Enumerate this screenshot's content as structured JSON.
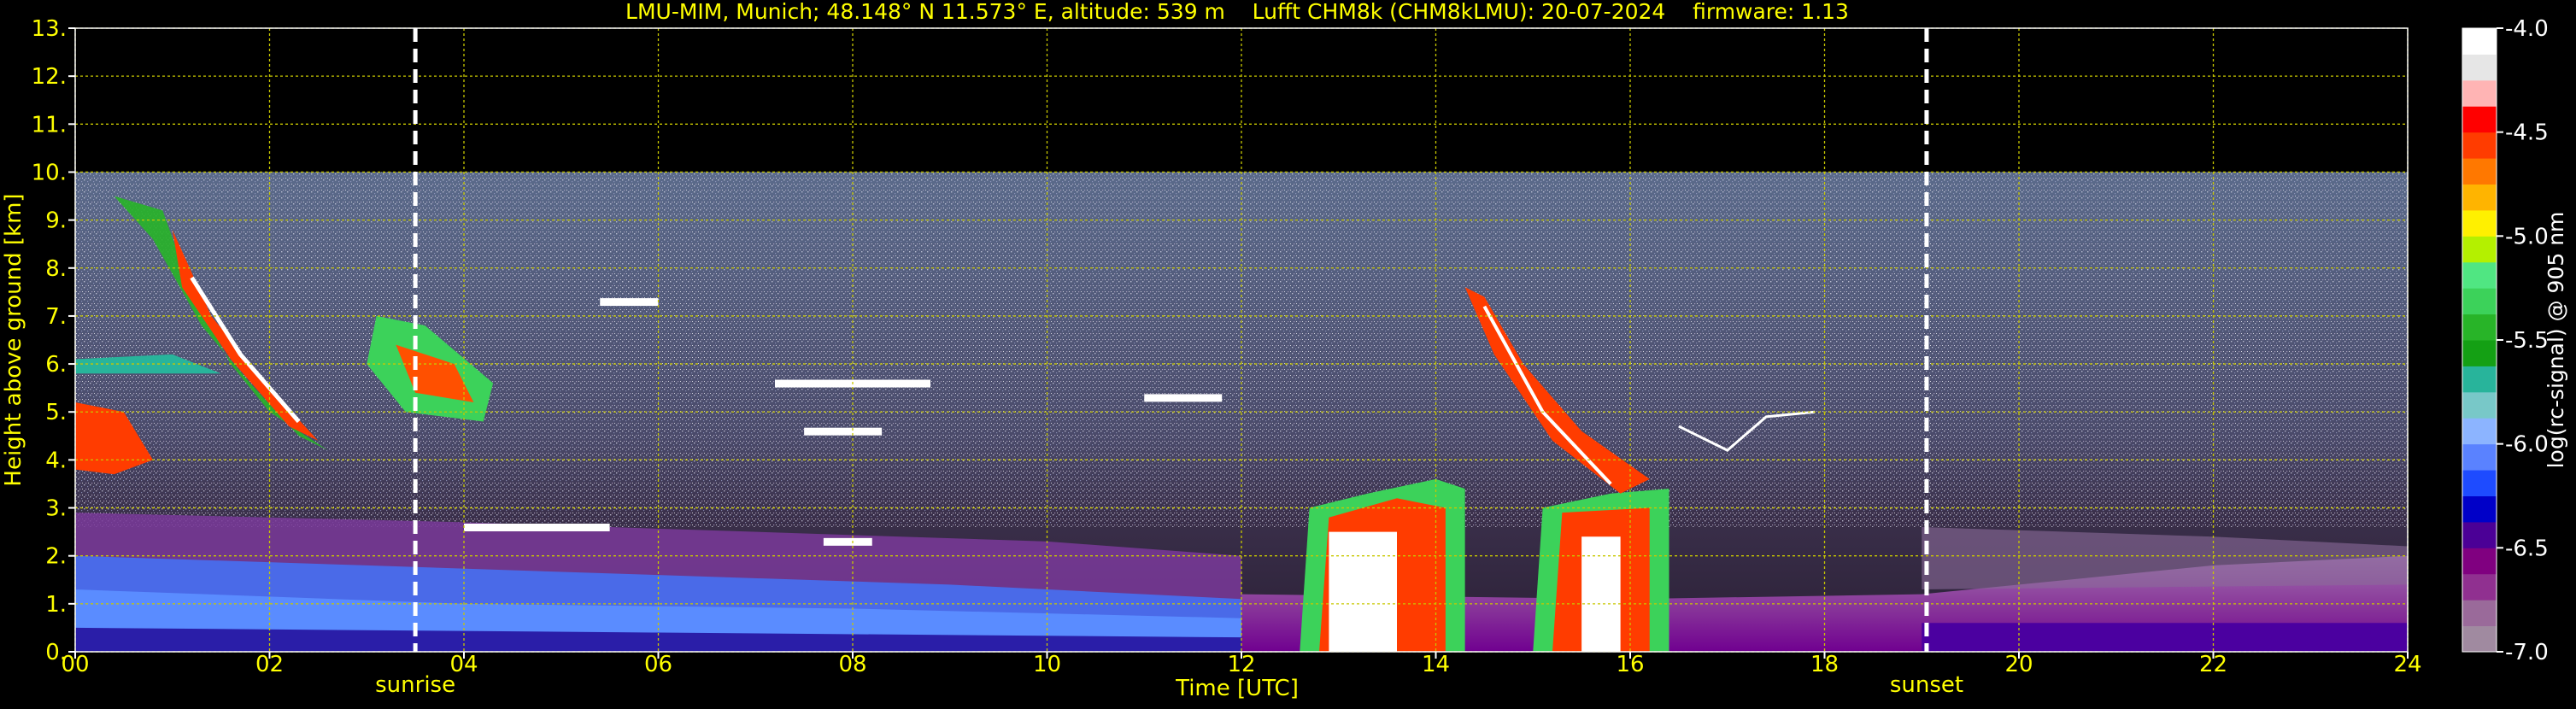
{
  "chart_data": {
    "type": "heatmap",
    "title": "LMU-MIM, Munich; 48.148° N 11.573° E, altitude: 539 m    Lufft CHM8k (CHM8kLMU): 20-07-2024    firmware: 1.13",
    "xlabel": "Time [UTC]",
    "ylabel": "Height above ground [km]",
    "colorbar_label": "log(rc-signal) @ 905 nm",
    "xlim": [
      0,
      24
    ],
    "ylim": [
      0,
      13
    ],
    "data_top_km": 10,
    "x_ticks": [
      0,
      2,
      4,
      6,
      8,
      10,
      12,
      14,
      16,
      18,
      20,
      22,
      24
    ],
    "x_tick_labels": [
      "00",
      "02",
      "04",
      "06",
      "08",
      "10",
      "12",
      "14",
      "16",
      "18",
      "20",
      "22",
      "24"
    ],
    "y_ticks": [
      0,
      1,
      2,
      3,
      4,
      5,
      6,
      7,
      8,
      9,
      10,
      11,
      12,
      13
    ],
    "y_tick_labels": [
      "0.",
      "1.",
      "2.",
      "3.",
      "4.",
      "5.",
      "6.",
      "7.",
      "8.",
      "9.",
      "10.",
      "11.",
      "12.",
      "13."
    ],
    "grid": true,
    "vlines": [
      {
        "label": "sunrise",
        "x": 3.5
      },
      {
        "label": "sunset",
        "x": 19.05
      }
    ],
    "colorbar": {
      "range": [
        -7.0,
        -4.0
      ],
      "ticks": [
        -7.0,
        -6.5,
        -6.0,
        -5.5,
        -5.0,
        -4.5,
        -4.0
      ],
      "tick_labels": [
        "-7.0",
        "-6.5",
        "-6.0",
        "-5.5",
        "-5.0",
        "-4.5",
        "-4.0"
      ],
      "colors_low_to_high": [
        "#a08aa0",
        "#9a6a9a",
        "#903090",
        "#800080",
        "#4b0096",
        "#0000c8",
        "#1e4bff",
        "#5a82ff",
        "#8cb4ff",
        "#78c8c8",
        "#28b49b",
        "#14a014",
        "#28b428",
        "#3cd25a",
        "#50e682",
        "#b4f000",
        "#fff000",
        "#ffb400",
        "#ff7800",
        "#ff3c00",
        "#ff0000",
        "#ffb4b4",
        "#e6e6e6",
        "#ffffff"
      ]
    },
    "colors": {
      "text": "#ffff00",
      "grid": "#c8c800",
      "background": "#000000",
      "vline": "#ffffff"
    }
  }
}
